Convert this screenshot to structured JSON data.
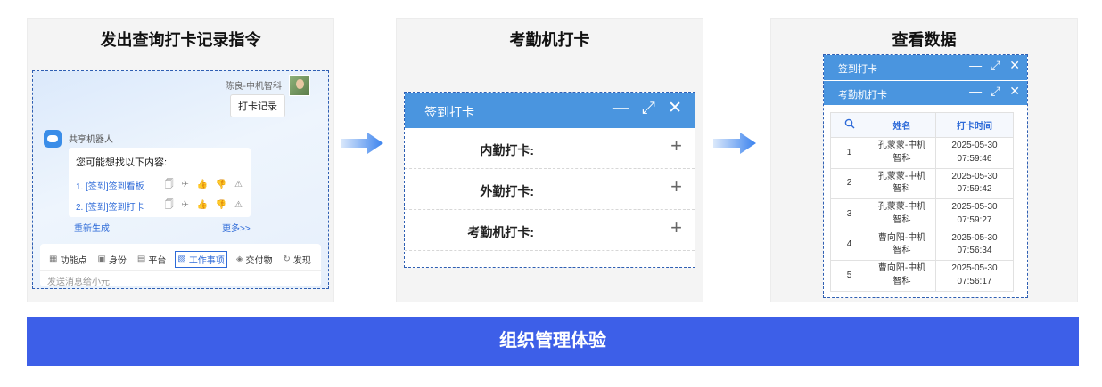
{
  "panel1": {
    "title": "发出查询打卡记录指令",
    "user_name": "陈良-中机智科",
    "user_message": "打卡记录",
    "bot_name": "共享机器人",
    "bot_question": "您可能想找以下内容:",
    "suggestions": [
      "1. [签到]签到看板",
      "2. [签到]签到打卡"
    ],
    "suggestion_actions": "🗍 ✈ 👍 👎 ⚠",
    "regenerate": "重新生成",
    "more": "更多>>",
    "toolbar": [
      {
        "icon": "▦",
        "label": "功能点"
      },
      {
        "icon": "▣",
        "label": "身份"
      },
      {
        "icon": "▤",
        "label": "平台"
      },
      {
        "icon": "▧",
        "label": "工作事项"
      },
      {
        "icon": "◈",
        "label": "交付物"
      },
      {
        "icon": "↻",
        "label": "发现"
      }
    ],
    "input_placeholder": "发送消息给小元"
  },
  "panel2": {
    "title": "考勤机打卡",
    "header": "签到打卡",
    "rows": [
      "内勤打卡:",
      "外勤打卡:",
      "考勤机打卡:"
    ]
  },
  "panel3": {
    "title": "查看数据",
    "bar1": "签到打卡",
    "bar2": "考勤机打卡",
    "table": {
      "headers": [
        "姓名",
        "打卡时间"
      ],
      "rows": [
        {
          "idx": "1",
          "name1": "孔蒙蒙-中机",
          "name2": "智科",
          "date": "2025-05-30",
          "time": "07:59:46"
        },
        {
          "idx": "2",
          "name1": "孔蒙蒙-中机",
          "name2": "智科",
          "date": "2025-05-30",
          "time": "07:59:42"
        },
        {
          "idx": "3",
          "name1": "孔蒙蒙-中机",
          "name2": "智科",
          "date": "2025-05-30",
          "time": "07:59:27"
        },
        {
          "idx": "4",
          "name1": "曹向阳-中机",
          "name2": "智科",
          "date": "2025-05-30",
          "time": "07:56:34"
        },
        {
          "idx": "5",
          "name1": "曹向阳-中机",
          "name2": "智科",
          "date": "2025-05-30",
          "time": "07:56:17"
        }
      ]
    }
  },
  "controls": {
    "minimize": "—",
    "maximize": "⤢",
    "close": "✕",
    "plus": "+",
    "search": "🔍"
  },
  "banner": "组织管理体验",
  "colors": {
    "accent_blue": "#4a95df",
    "banner": "#3d5fe8",
    "link": "#2d6ad8"
  }
}
